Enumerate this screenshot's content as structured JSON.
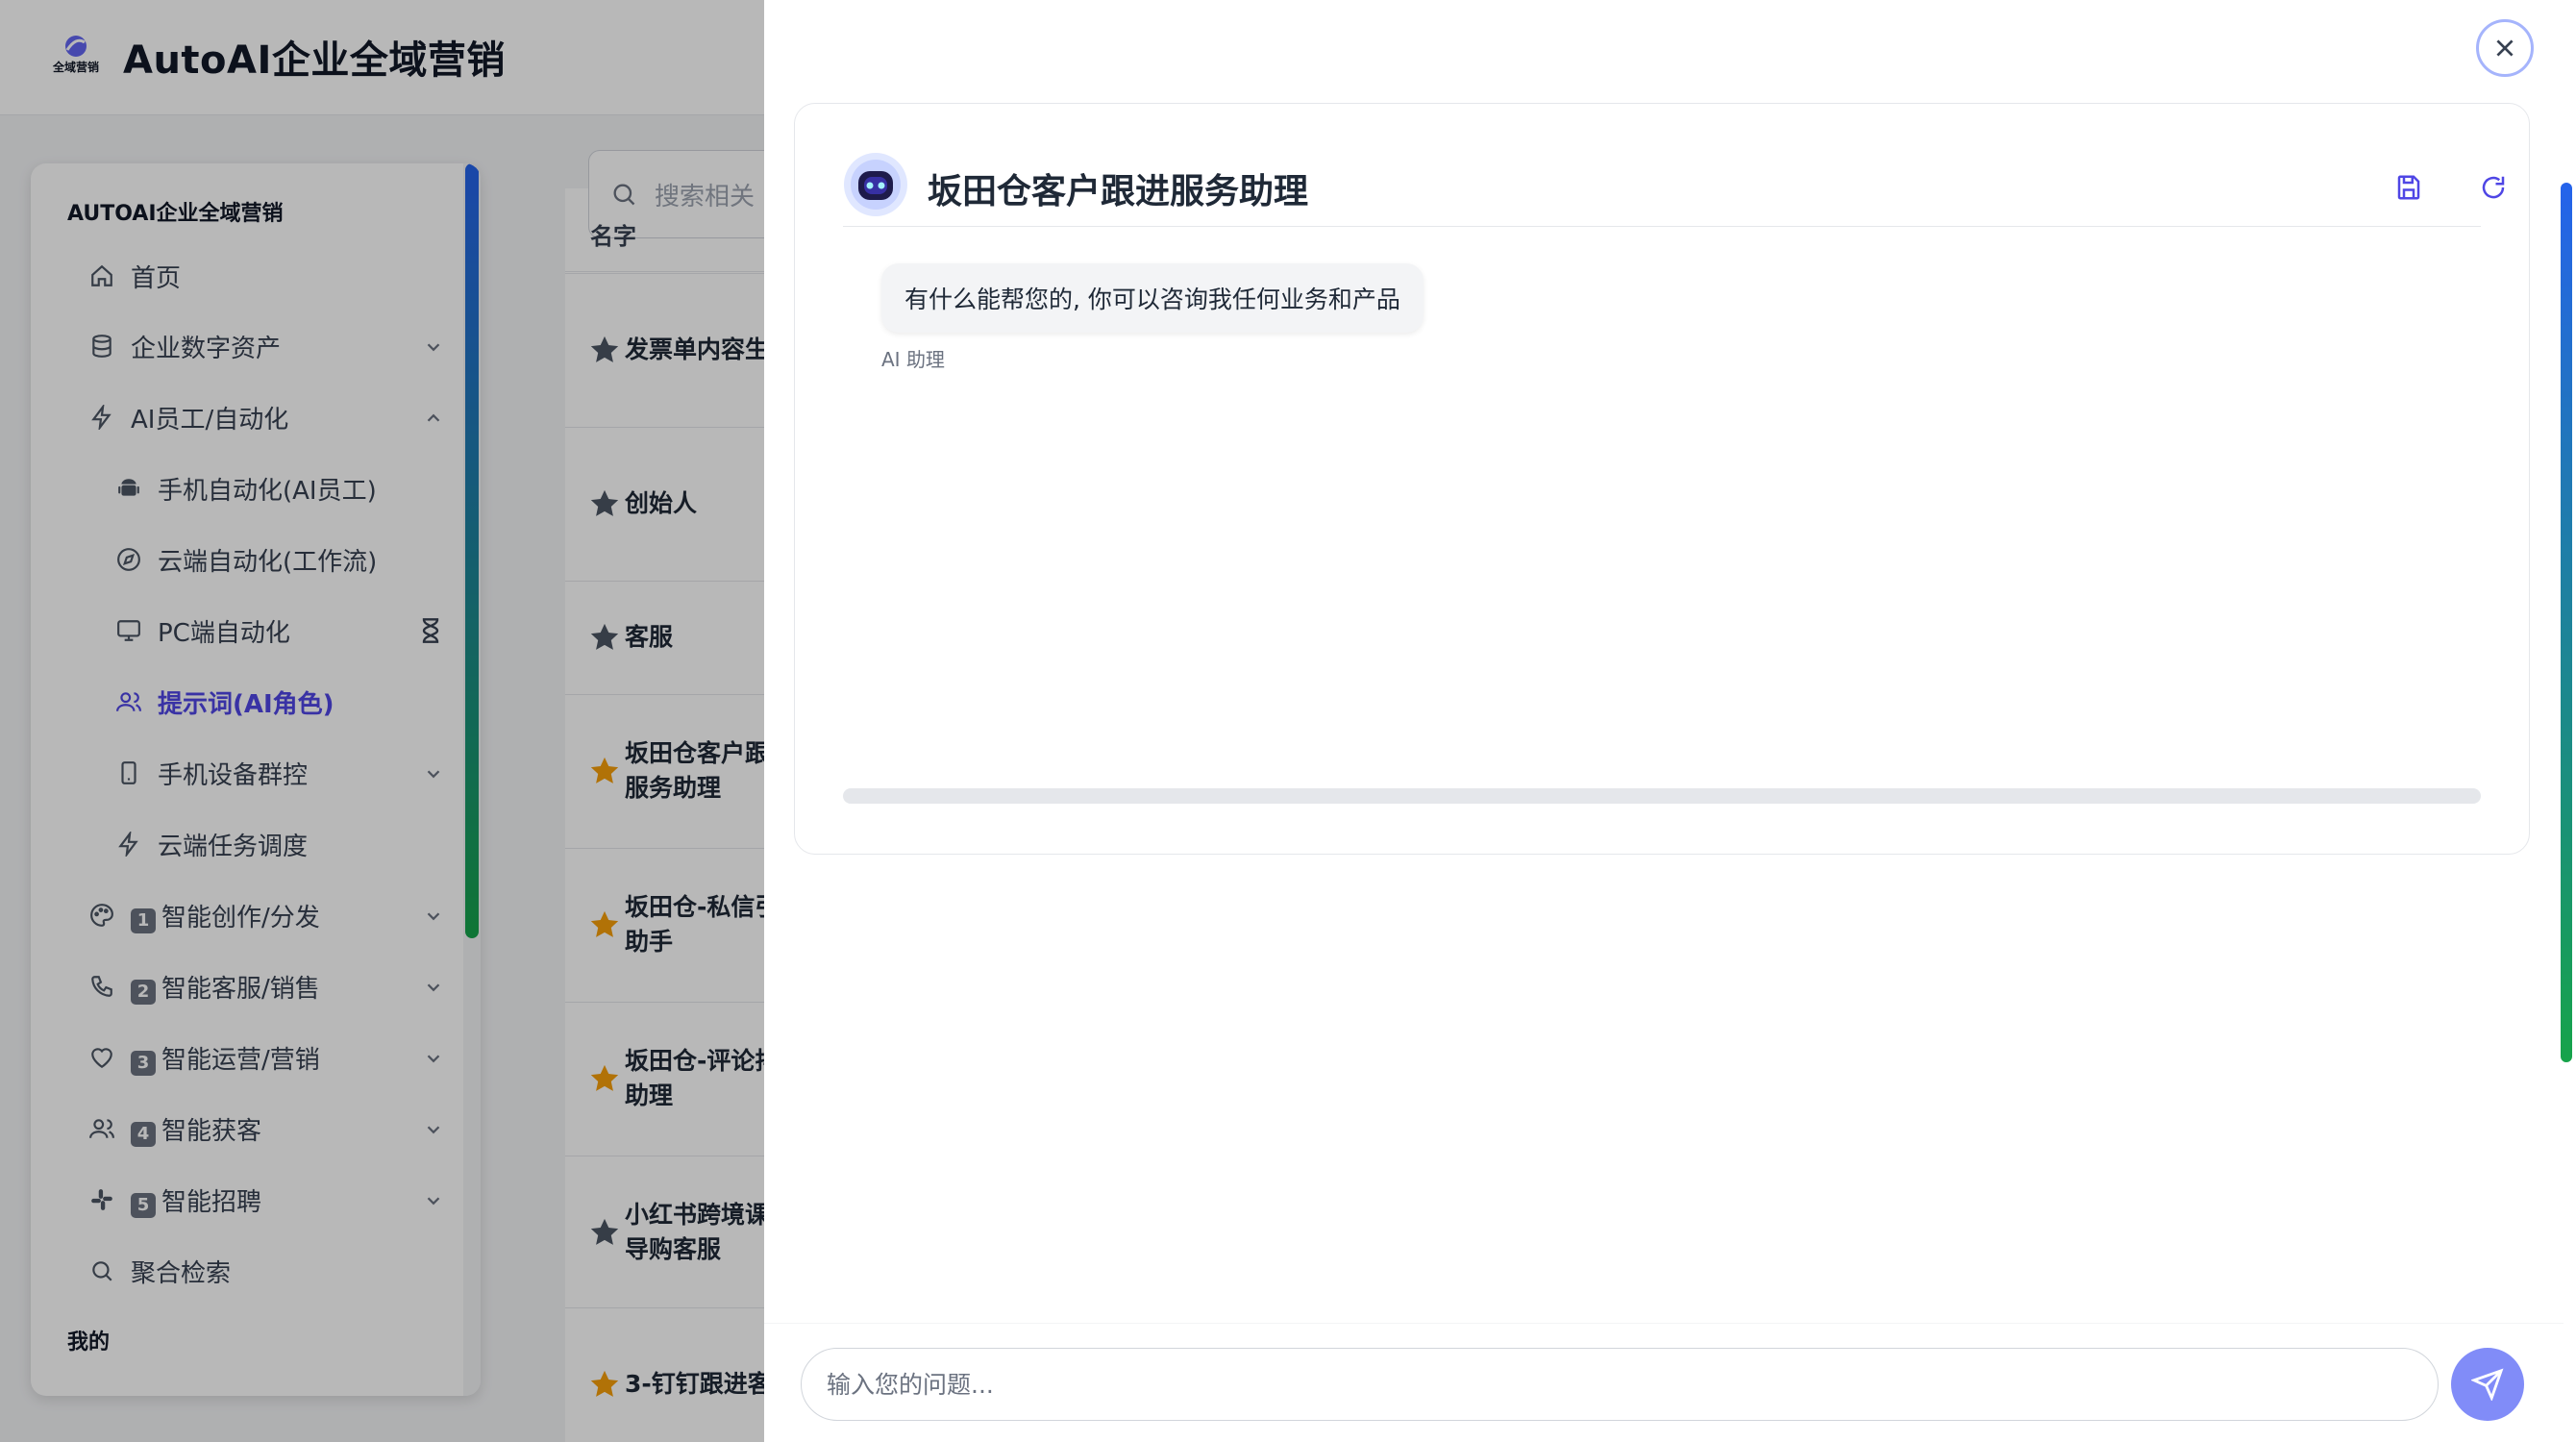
{
  "app": {
    "title": "AutoAI企业全域营销",
    "logo_text": "全域营销"
  },
  "sidebar": {
    "section_title": "AUTOAI企业全域营销",
    "items": [
      {
        "label": "首页",
        "icon": "home-icon"
      },
      {
        "label": "企业数字资产",
        "icon": "database-icon"
      },
      {
        "label": "AI员工/自动化",
        "icon": "lightning-icon"
      },
      {
        "label": "手机自动化(AI员工)",
        "icon": "android-icon"
      },
      {
        "label": "云端自动化(工作流)",
        "icon": "compass-icon"
      },
      {
        "label": "PC端自动化",
        "icon": "monitor-icon"
      },
      {
        "label": "提示词(AI角色)",
        "icon": "users-icon"
      },
      {
        "label": "手机设备群控",
        "icon": "phone-icon"
      },
      {
        "label": "云端任务调度",
        "icon": "lightning-icon"
      },
      {
        "label": "智能创作/分发",
        "badge": "1",
        "icon": "palette-icon"
      },
      {
        "label": "智能客服/销售",
        "badge": "2",
        "icon": "phone-call-icon"
      },
      {
        "label": "智能运营/营销",
        "badge": "3",
        "icon": "heart-icon"
      },
      {
        "label": "智能获客",
        "badge": "4",
        "icon": "users-icon"
      },
      {
        "label": "智能招聘",
        "badge": "5",
        "icon": "slack-icon"
      },
      {
        "label": "聚合检索",
        "icon": "search-icon"
      }
    ],
    "my_section": "我的"
  },
  "main": {
    "search_placeholder": "搜索相关",
    "table_header": "名字",
    "rows": [
      {
        "name": "发票单内容生",
        "starred": false
      },
      {
        "name": "创始人",
        "starred": false
      },
      {
        "name": "客服",
        "starred": false
      },
      {
        "name": "坂田仓客户跟\n服务助理",
        "starred": true
      },
      {
        "name": "坂田仓-私信引\n助手",
        "starred": true
      },
      {
        "name": "坂田仓-评论排\n助理",
        "starred": true
      },
      {
        "name": "小红书跨境课\n导购客服",
        "starred": false
      },
      {
        "name": "3-钉钉跟进客",
        "starred": true
      }
    ]
  },
  "chat": {
    "title": "坂田仓客户跟进服务助理",
    "messages": [
      {
        "text": "有什么能帮您的, 你可以咨询我任何业务和产品",
        "sender": "AI 助理"
      }
    ],
    "input_placeholder": "输入您的问题...",
    "colors": {
      "accent": "#4f46e5",
      "send_button": "#818cf8",
      "star_active": "#f59e0b",
      "star_inactive": "#4b5563"
    }
  }
}
